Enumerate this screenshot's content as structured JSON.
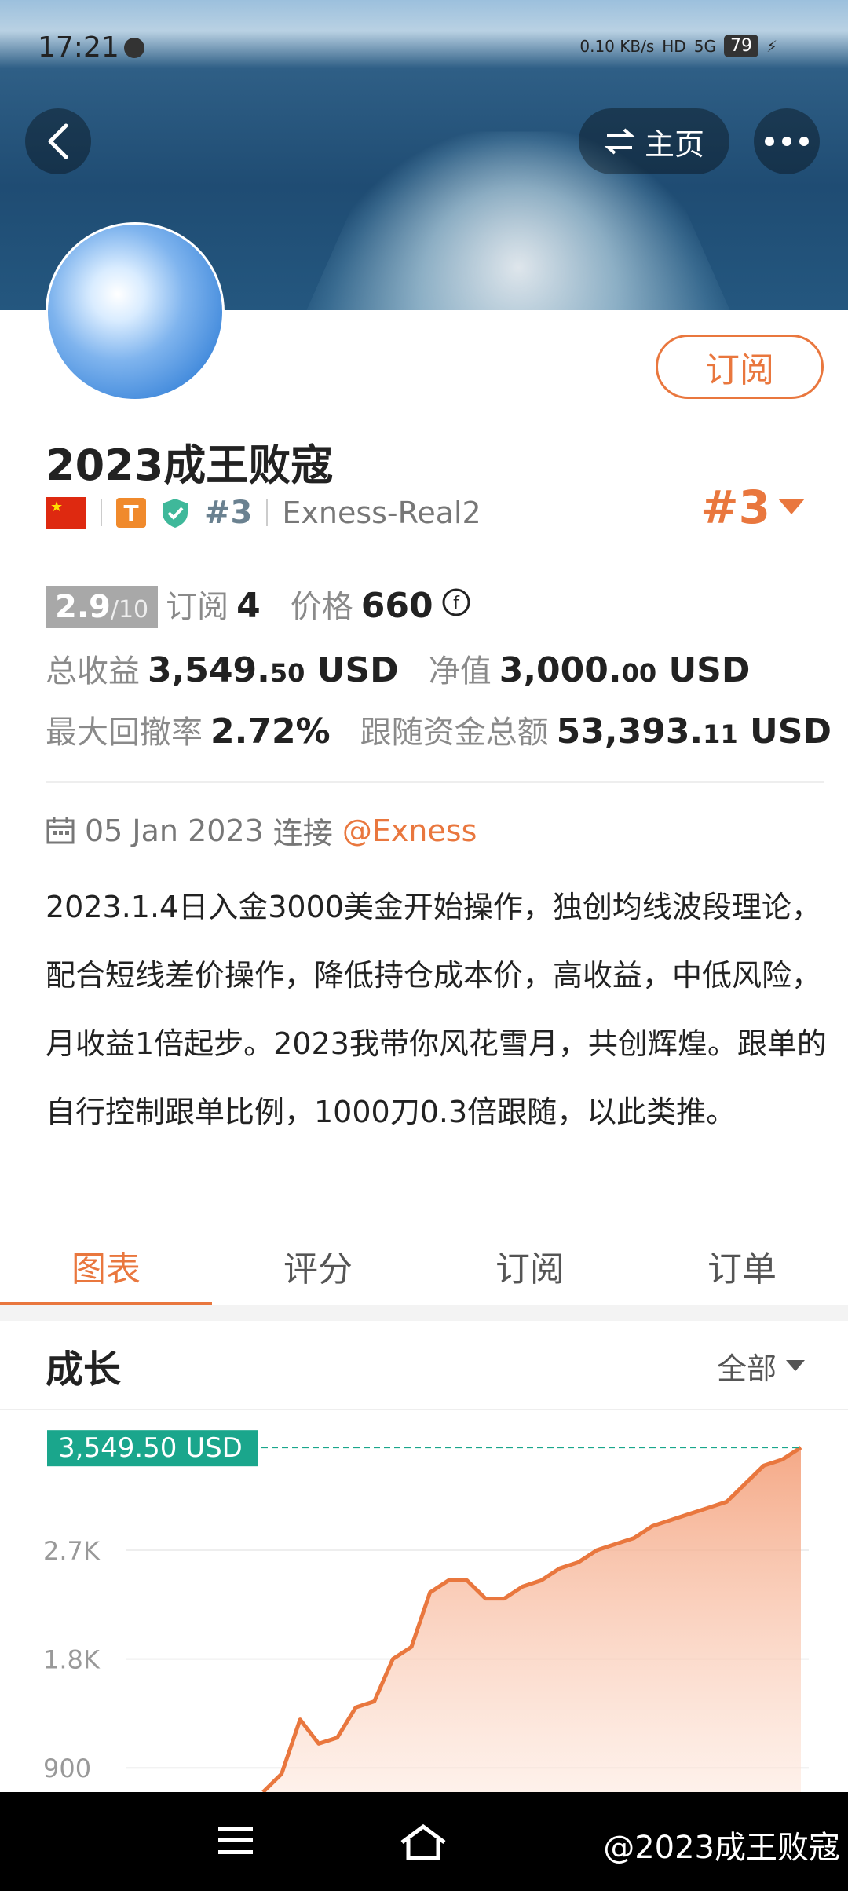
{
  "status_bar": {
    "time": "17:21",
    "net_speed": "0.10 KB/s",
    "hd": "HD",
    "signal": "5G",
    "battery": "79"
  },
  "header": {
    "home_label": "主页",
    "back_icon": "back-chevron-icon",
    "more_icon": "more-dots-icon"
  },
  "profile": {
    "subscribe_label": "订阅",
    "name": "2023成王败寇",
    "rank_small": "#3",
    "broker": "Exness-Real2",
    "rank_big": "#3",
    "t_badge": "T",
    "flag": "China"
  },
  "stats": {
    "score_main": "2.9",
    "score_suffix": "/10",
    "subs_label": "订阅",
    "subs_value": "4",
    "price_label": "价格",
    "price_value": "660",
    "total_label": "总收益",
    "total_int": "3,549.",
    "total_dec": "50",
    "total_unit": "USD",
    "equity_label": "净值",
    "equity_int": "3,000.",
    "equity_dec": "00",
    "equity_unit": "USD",
    "drawdown_label": "最大回撤率",
    "drawdown_value": "2.72%",
    "follow_label": "跟随资金总额",
    "follow_int": "53,393.",
    "follow_dec": "11",
    "follow_unit": "USD"
  },
  "info": {
    "date": "05 Jan 2023",
    "connect_label": "连接",
    "broker_link": "@Exness",
    "description": "2023.1.4日入金3000美金开始操作，独创均线波段理论，配合短线差价操作，降低持仓成本价，高收益，中低风险，月收益1倍起步。2023我带你风花雪月，共创辉煌。跟单的自行控制跟单比例，1000刀0.3倍跟随，以此类推。"
  },
  "tabs": [
    "图表",
    "评分",
    "订阅",
    "订单"
  ],
  "growth": {
    "title": "成长",
    "filter": "全部"
  },
  "chart_data": {
    "type": "area",
    "current_label": "3,549.50 USD",
    "y_ticks": [
      "2.7K",
      "1.8K",
      "900"
    ],
    "ylim": [
      700,
      3700
    ],
    "color": "#e9773e",
    "values": [
      700,
      850,
      1300,
      1100,
      1150,
      1400,
      1450,
      1800,
      1900,
      2350,
      2450,
      2450,
      2300,
      2300,
      2400,
      2450,
      2550,
      2600,
      2700,
      2750,
      2800,
      2900,
      2950,
      3000,
      3050,
      3100,
      3250,
      3400,
      3450,
      3549.5
    ]
  },
  "navbar": {
    "watermark": "@2023成王败寇"
  }
}
